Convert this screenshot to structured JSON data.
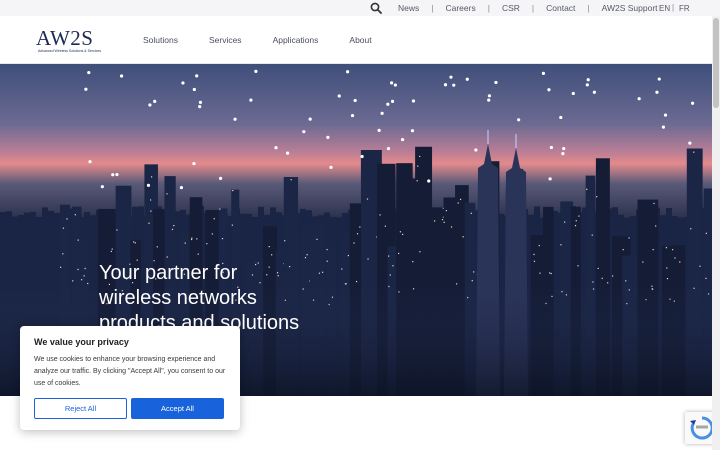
{
  "topbar": {
    "links": [
      "News",
      "Careers",
      "CSR",
      "Contact",
      "AW2S Support"
    ],
    "languages": [
      "EN",
      "FR"
    ]
  },
  "header": {
    "logo_text": "AW2S",
    "logo_subtitle": "Advanced Wireless Solutions & Services",
    "nav": [
      "Solutions",
      "Services",
      "Applications",
      "About"
    ]
  },
  "hero": {
    "title_lines": [
      "Your partner for",
      "wireless networks",
      "products and solutions"
    ]
  },
  "cookie": {
    "title": "We value your privacy",
    "text": "We use cookies to enhance your browsing experience and analyze our traffic. By clicking \"Accept All\", you consent to our use of cookies.",
    "reject_label": "Reject All",
    "accept_label": "Accept All"
  },
  "colors": {
    "accent": "#1863dc",
    "logo": "#1d2a55"
  },
  "icons": [
    "search-icon",
    "recaptcha-icon"
  ]
}
